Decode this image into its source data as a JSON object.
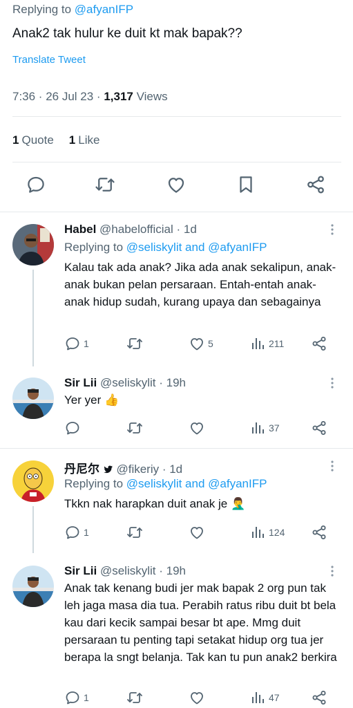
{
  "main_tweet": {
    "replying_prefix": "Replying to ",
    "replying_handle": "@afyanIFP",
    "text": "Anak2 tak hulur ke duit kt mak bapak??",
    "translate": "Translate Tweet",
    "time": "7:36 · 26 Jul 23 · ",
    "views_count": "1,317",
    "views_label": " Views",
    "quote_count": "1",
    "quote_label": "Quote",
    "like_count": "1",
    "like_label": "Like"
  },
  "replies": [
    {
      "name": "Habel",
      "handle": "@habelofficial · 1d",
      "replying_prefix": "Replying to ",
      "replying_handles": "@seliskylit and @afyanIFP",
      "text": "Kalau tak ada anak? Jika ada anak sekalipun, anak-anak bukan pelan persaraan. Entah-entah anak-anak hidup sudah, kurang upaya dan sebagainya",
      "reply_count": "1",
      "retweet_count": "",
      "like_count": "5",
      "view_count": "211"
    },
    {
      "name": "Sir Lii",
      "handle": "@seliskylit · 19h",
      "text": "Yer yer 👍",
      "reply_count": "",
      "retweet_count": "",
      "like_count": "",
      "view_count": "37"
    },
    {
      "name": "丹尼尔",
      "handle": "@fikeriy · 1d",
      "replying_prefix": "Replying to ",
      "replying_handles": "@seliskylit and @afyanIFP",
      "text": "Tkkn nak harapkan duit anak je 🤦‍♂️",
      "reply_count": "1",
      "retweet_count": "",
      "like_count": "",
      "view_count": "124"
    },
    {
      "name": "Sir Lii",
      "handle": "@seliskylit · 19h",
      "text": "Anak tak kenang budi jer mak bapak 2 org pun tak leh jaga masa dia tua. Perabih ratus ribu duit bt bela kau dari kecik sampai besar bt ape. Mmg duit persaraan tu penting tapi setakat hidup org tua jer berapa la sngt belanja. Tak kan tu pun anak2 berkira",
      "reply_count": "1",
      "retweet_count": "",
      "like_count": "",
      "view_count": "47"
    }
  ],
  "colors": {
    "accent": "#1d9bf0",
    "text": "#0f1419",
    "secondary": "#536471",
    "divider": "#e6e9eb"
  }
}
